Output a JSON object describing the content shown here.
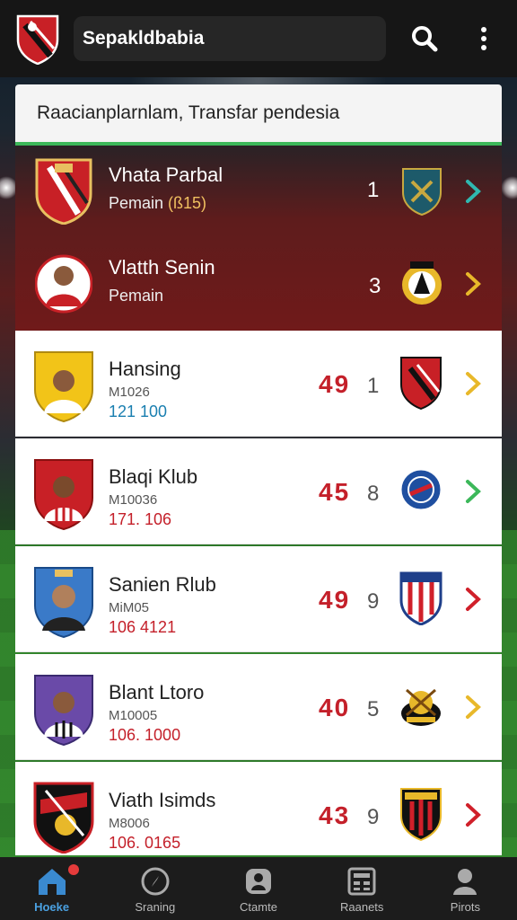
{
  "app": {
    "title": "Sepakldbabia"
  },
  "section": {
    "heading": "Raacianplarnlam, Transfar pendesia"
  },
  "featured": [
    {
      "name": "Vhata Parbal",
      "role": "Pemain",
      "tag": "(ß15)",
      "rank": "1",
      "chevron_color": "#2fb8b0"
    },
    {
      "name": "Vlatth Senin",
      "role": "Pemain",
      "tag": "",
      "rank": "3",
      "chevron_color": "#e8b82a"
    }
  ],
  "players": [
    {
      "name": "Hansing",
      "code": "M1026",
      "value": "121 100",
      "value_color": "#1a7fb0",
      "score": "49",
      "rank": "1",
      "chevron_color": "#e8b82a"
    },
    {
      "name": "Blaqi Klub",
      "code": "M10036",
      "value": "171. 106",
      "value_color": "#c4202a",
      "score": "45",
      "rank": "8",
      "chevron_color": "#3cb85a"
    },
    {
      "name": "Sanien Rlub",
      "code": "MiM05",
      "value": "106 4121",
      "value_color": "#c4202a",
      "score": "49",
      "rank": "9",
      "chevron_color": "#d0202a"
    },
    {
      "name": "Blant Ltoro",
      "code": "M10005",
      "value": "106. 1000",
      "value_color": "#c4202a",
      "score": "40",
      "rank": "5",
      "chevron_color": "#e8b82a"
    },
    {
      "name": "Viath Isimds",
      "code": "M8006",
      "value": "106. 0165",
      "value_color": "#c4202a",
      "score": "43",
      "rank": "9",
      "chevron_color": "#d0202a"
    }
  ],
  "nav": [
    {
      "label": "Hoeke",
      "icon": "home-icon",
      "active": true
    },
    {
      "label": "Sraning",
      "icon": "compass-icon",
      "active": false
    },
    {
      "label": "Ctamte",
      "icon": "player-icon",
      "active": false
    },
    {
      "label": "Raanets",
      "icon": "grid-icon",
      "active": false
    },
    {
      "label": "Pirots",
      "icon": "profile-icon",
      "active": false
    }
  ],
  "colors": {
    "accent_green": "#3cb85a",
    "score_red": "#c4202a",
    "nav_active": "#4aa0e0"
  }
}
